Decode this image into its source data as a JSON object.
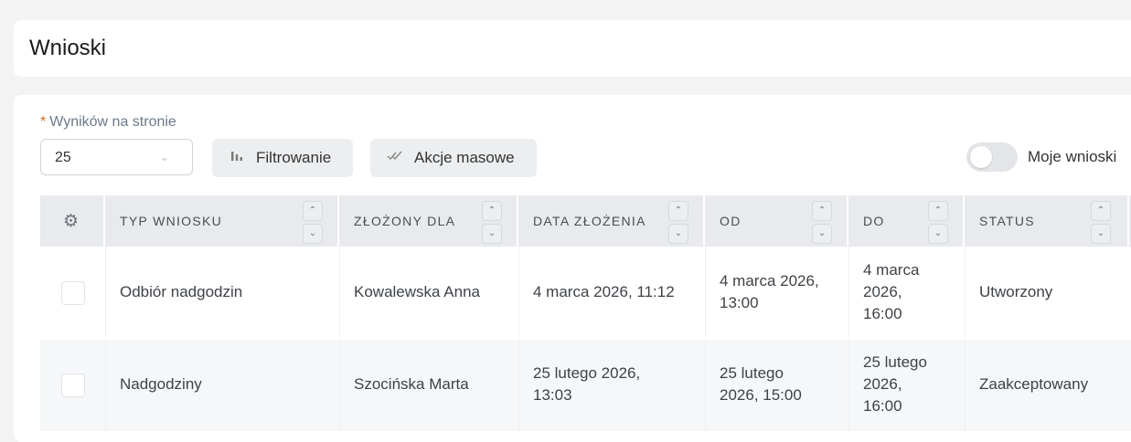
{
  "page": {
    "title": "Wnioski"
  },
  "toolbar": {
    "per_page_required_mark": "*",
    "per_page_label": "Wyników na stronie",
    "per_page_value": "25",
    "filter_label": "Filtrowanie",
    "mass_actions_label": "Akcje masowe",
    "my_requests_label": "Moje wnioski",
    "my_requests_on": false
  },
  "table": {
    "columns": [
      "TYP WNIOSKU",
      "ZŁOŻONY DLA",
      "DATA ZŁOŻENIA",
      "OD",
      "DO",
      "STATUS"
    ],
    "rows": [
      {
        "type": "Odbiór nadgodzin",
        "for": "Kowalewska Anna",
        "submitted": "4 marca 2026, 11:12",
        "from_line1": "4 marca 2026,",
        "from_line2": "13:00",
        "to_line1": "4 marca",
        "to_line2": "2026,",
        "to_line3": "16:00",
        "status": "Utworzony"
      },
      {
        "type": "Nadgodziny",
        "for": "Szocińska Marta",
        "submitted_line1": "25 lutego 2026,",
        "submitted_line2": "13:03",
        "from_line1": "25 lutego",
        "from_line2": "2026, 15:00",
        "to_line1": "25 lutego",
        "to_line2": "2026,",
        "to_line3": "16:00",
        "status": "Zaakceptowany"
      }
    ]
  },
  "icons": {
    "sort_up": "chevron-up-icon",
    "sort_down": "chevron-down-icon",
    "settings": "gear-icon",
    "filter": "bar-chart-icon",
    "mass": "double-check-icon"
  }
}
